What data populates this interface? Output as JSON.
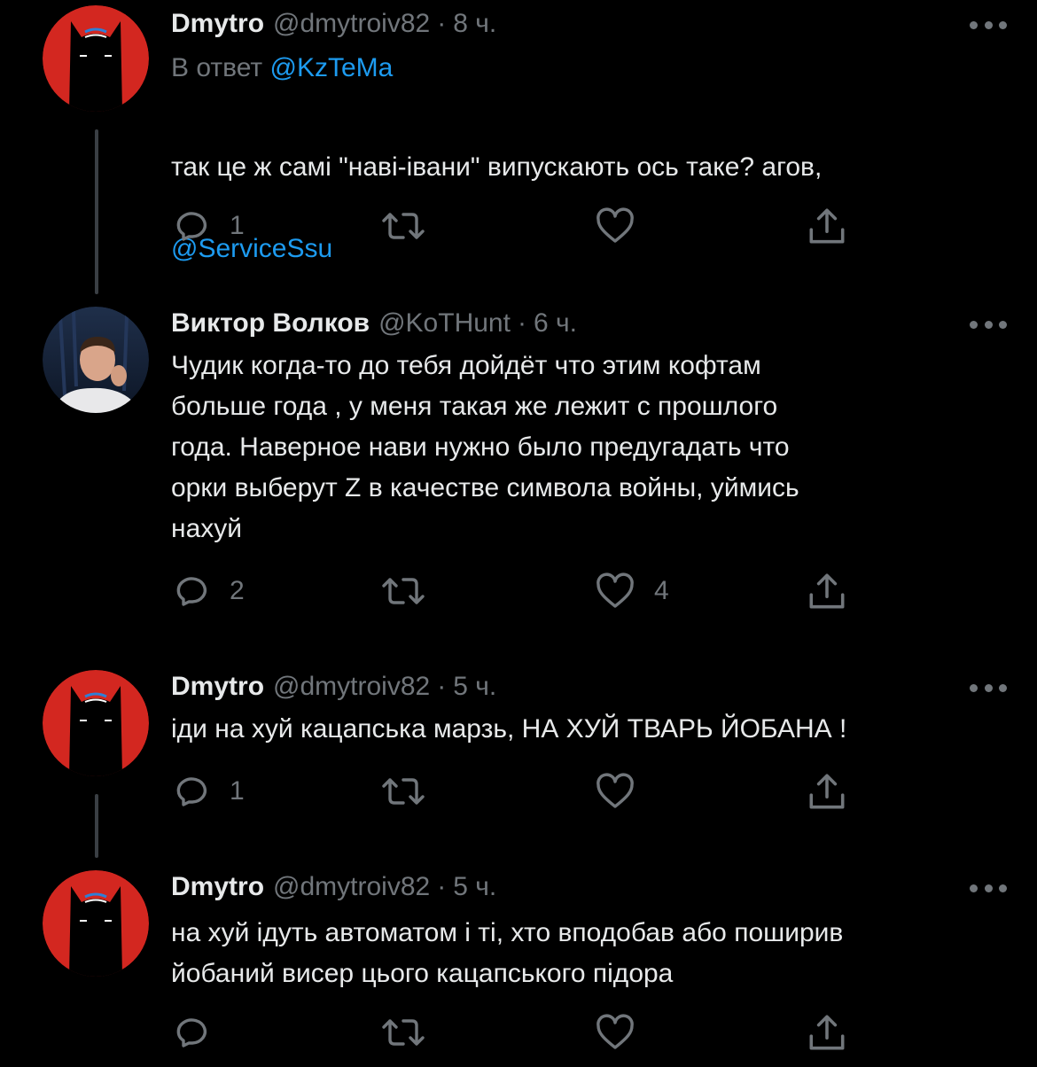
{
  "tweets": [
    {
      "name": "Dmytro",
      "handle": "@dmytroiv82",
      "time": "8 ч.",
      "avatar": "batman-avatar",
      "reply_prefix": "В ответ",
      "reply_handle": "@KzTeMa",
      "text": "так це ж самі \"наві-івани\" випускають ось таке? агов,",
      "mention": "@ServiceSsu",
      "replies": "1",
      "retweets": "",
      "likes": "",
      "share": ""
    },
    {
      "name": "Виктор Волков",
      "handle": "@KoTHunt",
      "time": "6 ч.",
      "avatar": "photo-avatar",
      "text": "Чудик когда-то до тебя дойдёт что этим кофтам\nбольше года , у меня такая же лежит с прошлого\nгода. Наверное нави нужно было предугадать что\nорки выберут Z в качестве символа войны, уймись\nнахуй",
      "replies": "2",
      "retweets": "",
      "likes": "4",
      "share": ""
    },
    {
      "name": "Dmytro",
      "handle": "@dmytroiv82",
      "time": "5 ч.",
      "avatar": "batman-avatar",
      "text": "іди на хуй кацапська марзь, НА ХУЙ ТВАРЬ ЙОБАНА !",
      "replies": "1",
      "retweets": "",
      "likes": "",
      "share": ""
    },
    {
      "name": "Dmytro",
      "handle": "@dmytroiv82",
      "time": "5 ч.",
      "avatar": "batman-avatar",
      "text": "на хуй ідуть автоматом і ті, хто вподобав або поширив\n йобаний висер цього кацапського підора",
      "replies": "",
      "retweets": "",
      "likes": "",
      "share": ""
    }
  ],
  "separator": "·",
  "colors": {
    "background": "#000000",
    "text": "#e7e9ea",
    "muted": "#71767b",
    "link": "#1d9bf0",
    "avatar_red": "#d32720"
  },
  "icons": {
    "reply": "reply-icon",
    "retweet": "retweet-icon",
    "like": "like-icon",
    "share": "share-icon",
    "more": "more-icon"
  }
}
